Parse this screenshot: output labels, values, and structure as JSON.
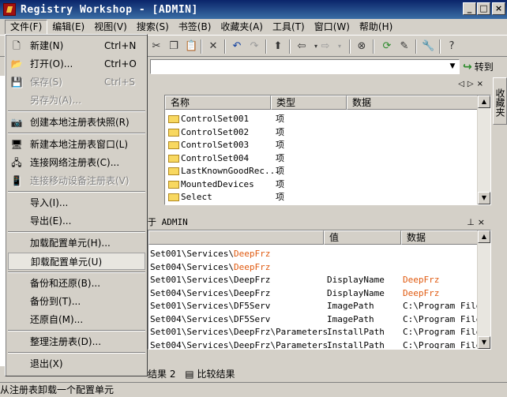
{
  "window": {
    "title": "Registry Workshop - [ADMIN]"
  },
  "menubar": [
    "文件(F)",
    "编辑(E)",
    "视图(V)",
    "搜索(S)",
    "书签(B)",
    "收藏夹(A)",
    "工具(T)",
    "窗口(W)",
    "帮助(H)"
  ],
  "toolbar": {
    "goto_label": "转到"
  },
  "file_menu": {
    "items": [
      {
        "label": "新建(N)",
        "shortcut": "Ctrl+N",
        "icon": "new-icon",
        "disabled": false
      },
      {
        "label": "打开(O)...",
        "shortcut": "Ctrl+O",
        "icon": "open-folder-icon",
        "disabled": false
      },
      {
        "label": "保存(S)",
        "shortcut": "Ctrl+S",
        "icon": "save-icon",
        "disabled": true
      },
      {
        "label": "另存为(A)...",
        "shortcut": "",
        "icon": "",
        "disabled": true
      },
      {
        "label": "创建本地注册表快照(R)",
        "shortcut": "",
        "icon": "camera-icon",
        "disabled": false
      },
      {
        "label": "新建本地注册表窗口(L)",
        "shortcut": "",
        "icon": "computer-icon",
        "disabled": false
      },
      {
        "label": "连接网络注册表(C)...",
        "shortcut": "",
        "icon": "network-icon",
        "disabled": false
      },
      {
        "label": "连接移动设备注册表(V)",
        "shortcut": "",
        "icon": "mobile-device-icon",
        "disabled": true
      },
      {
        "label": "导入(I)...",
        "shortcut": "",
        "icon": "",
        "disabled": false
      },
      {
        "label": "导出(E)...",
        "shortcut": "",
        "icon": "",
        "disabled": false
      },
      {
        "label": "加载配置单元(H)...",
        "shortcut": "",
        "icon": "",
        "disabled": false
      },
      {
        "label": "卸载配置单元(U)",
        "shortcut": "",
        "icon": "",
        "disabled": false,
        "highlighted": true
      },
      {
        "label": "备份和还原(B)...",
        "shortcut": "",
        "icon": "",
        "disabled": false
      },
      {
        "label": "备份到(T)...",
        "shortcut": "",
        "icon": "",
        "disabled": false
      },
      {
        "label": "还原自(M)...",
        "shortcut": "",
        "icon": "",
        "disabled": false
      },
      {
        "label": "整理注册表(D)...",
        "shortcut": "",
        "icon": "",
        "disabled": false
      },
      {
        "label": "退出(X)",
        "shortcut": "",
        "icon": "",
        "disabled": false
      }
    ]
  },
  "list_view": {
    "columns": [
      "名称",
      "类型",
      "数据"
    ],
    "rows": [
      {
        "name": "ControlSet001",
        "type": "项"
      },
      {
        "name": "ControlSet002",
        "type": "项"
      },
      {
        "name": "ControlSet003",
        "type": "项"
      },
      {
        "name": "ControlSet004",
        "type": "项"
      },
      {
        "name": "LastKnownGoodRec...",
        "type": "项"
      },
      {
        "name": "MountedDevices",
        "type": "项"
      },
      {
        "name": "Select",
        "type": "项"
      }
    ]
  },
  "fav_tab": "收藏夹",
  "lower_pane": {
    "title": "于 ADMIN",
    "columns": [
      "值",
      "数据"
    ],
    "rows": [
      {
        "path_a": "Set001\\Services\\",
        "path_b": "DeepFrz",
        "path_c": "",
        "val": "",
        "dat_a": "",
        "dat_b": ""
      },
      {
        "path_a": "Set004\\Services\\",
        "path_b": "DeepFrz",
        "path_c": "",
        "val": "",
        "dat_a": "",
        "dat_b": ""
      },
      {
        "path_a": "Set001\\Services\\DeepFrz",
        "path_b": "",
        "path_c": "",
        "val": "DisplayName",
        "dat_a": "",
        "dat_b": "DeepFrz"
      },
      {
        "path_a": "Set004\\Services\\DeepFrz",
        "path_b": "",
        "path_c": "",
        "val": "DisplayName",
        "dat_a": "",
        "dat_b": "DeepFrz"
      },
      {
        "path_a": "Set001\\Services\\DF5Serv",
        "path_b": "",
        "path_c": "",
        "val": "ImagePath",
        "dat_a": "C:\\Program Files",
        "dat_b": ""
      },
      {
        "path_a": "Set004\\Services\\DF5Serv",
        "path_b": "",
        "path_c": "",
        "val": "ImagePath",
        "dat_a": "C:\\Program Files",
        "dat_b": ""
      },
      {
        "path_a": "Set001\\Services\\DeepFrz\\Parameters",
        "path_b": "",
        "path_c": "",
        "val": "InstallPath",
        "dat_a": "C:\\Program Files",
        "dat_b": ""
      },
      {
        "path_a": "Set004\\Services\\DeepFrz\\Parameters",
        "path_b": "",
        "path_c": "",
        "val": "InstallPath",
        "dat_a": "C:\\Program Files",
        "dat_b": ""
      }
    ]
  },
  "bottom_tabs": [
    "结果 2",
    "比较结果"
  ],
  "status": "从注册表卸载一个配置单元"
}
